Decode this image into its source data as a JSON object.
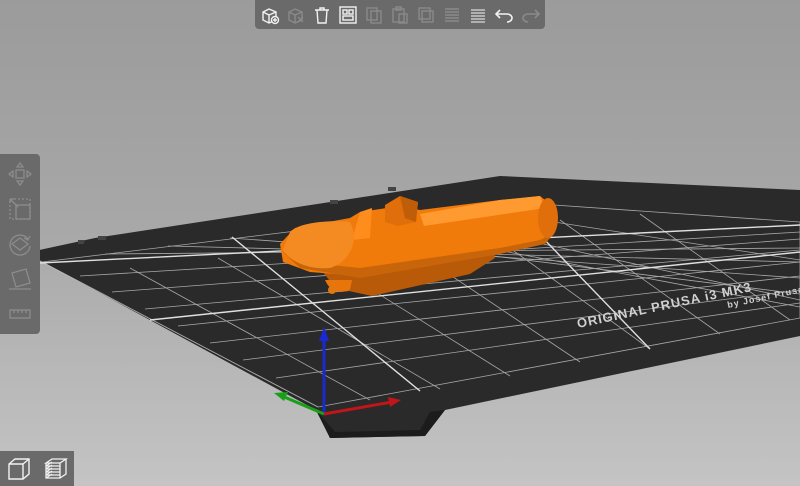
{
  "bed": {
    "brand_text": "ORIGINAL PRUSA i3 MK3",
    "sub_text": "by Josef Prusa"
  },
  "colors": {
    "background_top": "#9b9b9b",
    "background_bottom": "#c4c4c4",
    "toolbar": "#6a6a6a",
    "bed": "#2b2b2b",
    "grid": "#bfbfbf",
    "model": "#f07a0a",
    "axis_x": "#c0161a",
    "axis_y": "#18a018",
    "axis_z": "#1a2ad0"
  },
  "top_toolbar": [
    {
      "name": "add-icon",
      "enabled": true
    },
    {
      "name": "delete-icon",
      "enabled": false
    },
    {
      "name": "delete-all-icon",
      "enabled": true
    },
    {
      "name": "arrange-icon",
      "enabled": true
    },
    {
      "name": "copy-icon",
      "enabled": false
    },
    {
      "name": "paste-icon",
      "enabled": false
    },
    {
      "name": "add-instance-icon",
      "enabled": false
    },
    {
      "name": "split-to-objects-icon",
      "enabled": false
    },
    {
      "name": "layers-editing-icon",
      "enabled": false
    },
    {
      "name": "undo-icon",
      "enabled": true
    },
    {
      "name": "redo-icon",
      "enabled": false
    }
  ],
  "left_toolbar": [
    {
      "name": "move-icon"
    },
    {
      "name": "scale-icon"
    },
    {
      "name": "rotate-icon"
    },
    {
      "name": "place-on-face-icon"
    },
    {
      "name": "cut-icon"
    }
  ],
  "view_switch": [
    {
      "name": "3d-view-icon"
    },
    {
      "name": "preview-icon"
    }
  ]
}
